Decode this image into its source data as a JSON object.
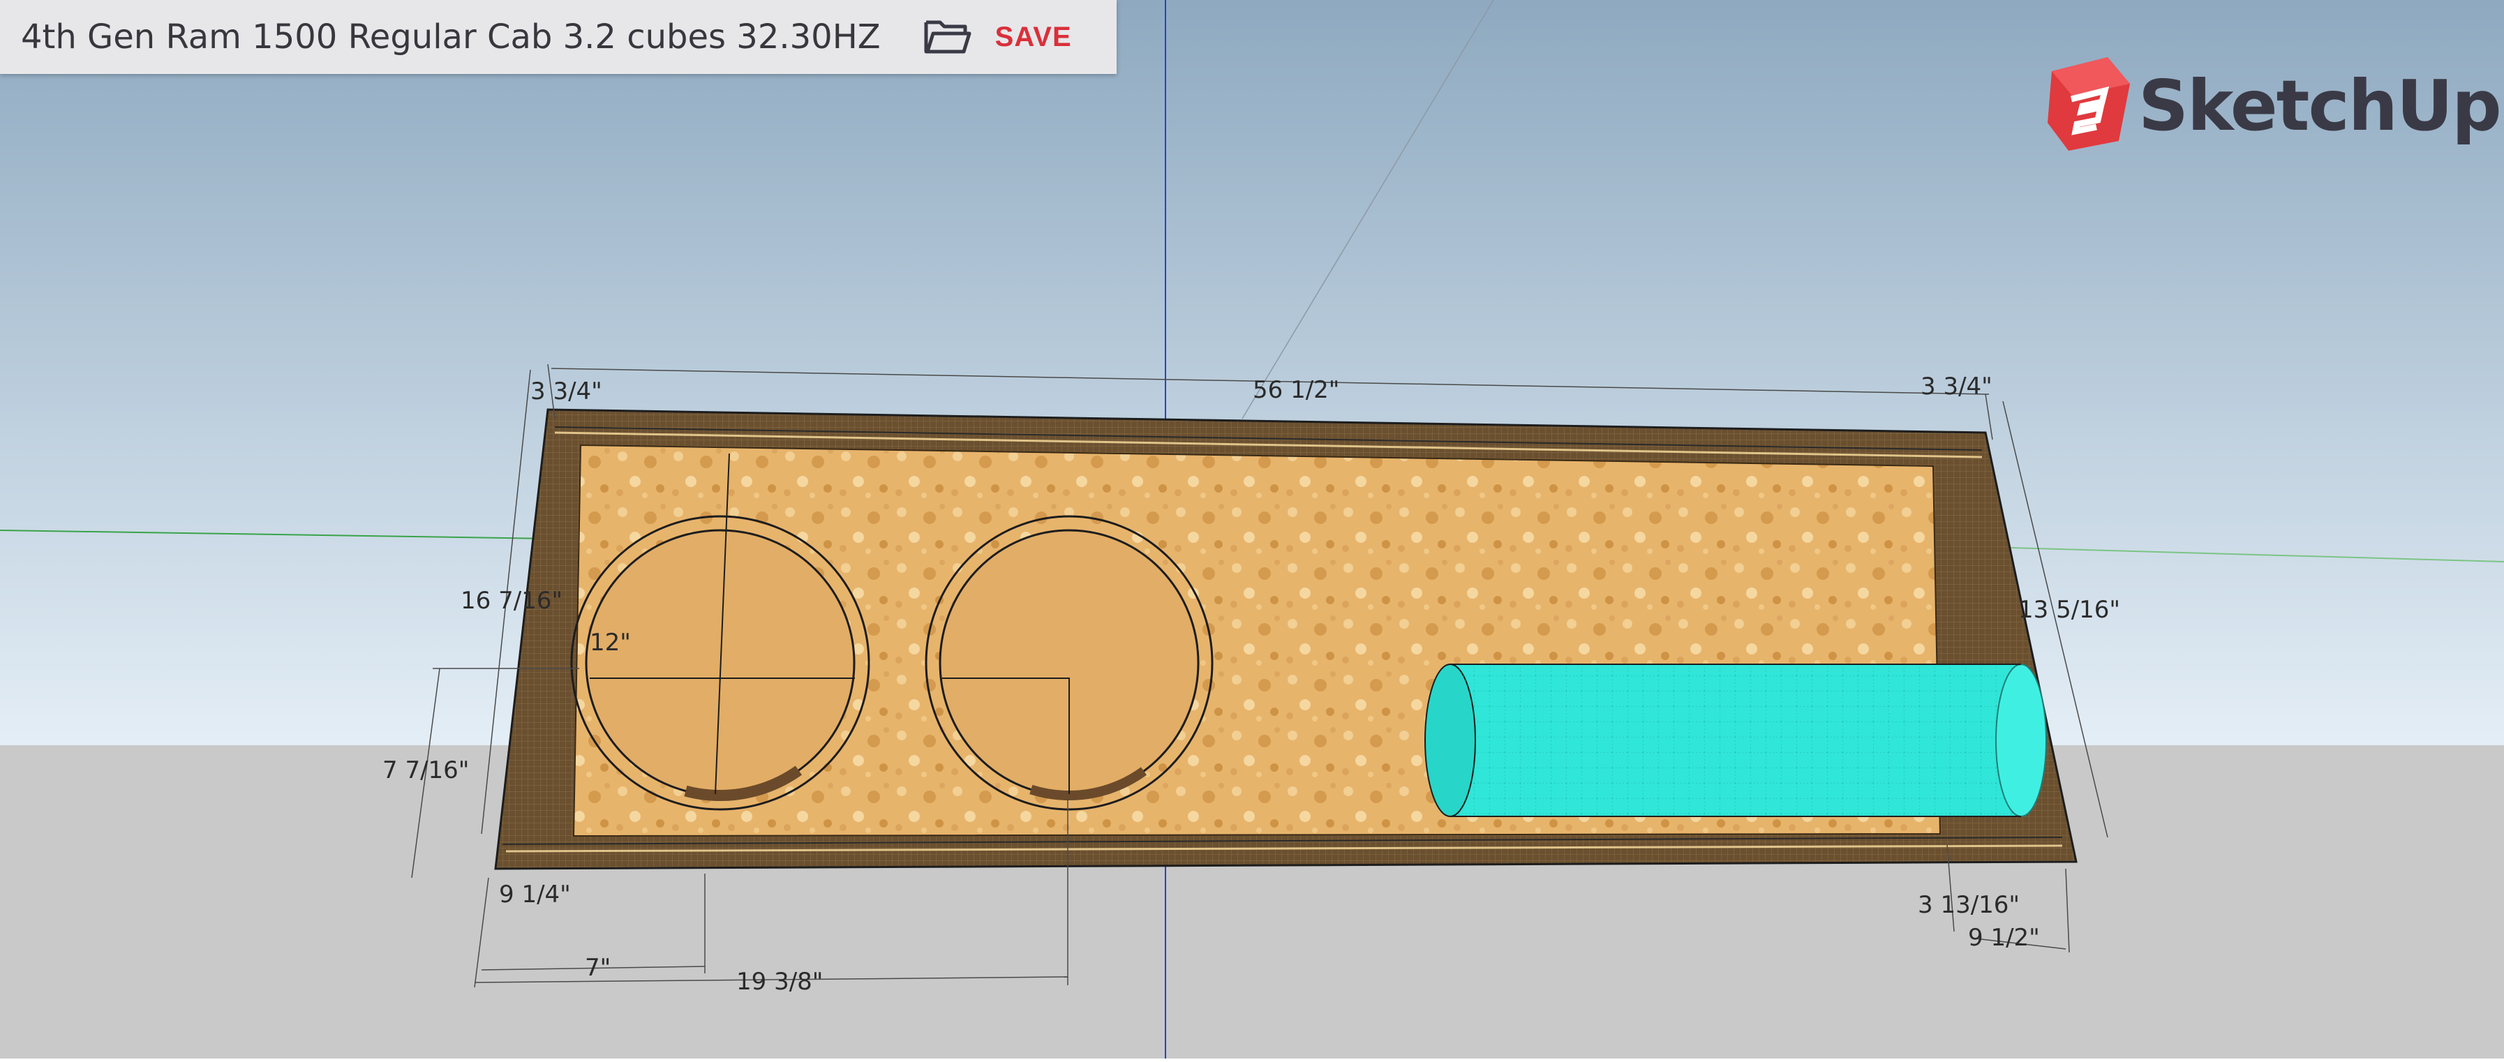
{
  "app": {
    "model_title": "4th Gen Ram 1500 Regular Cab 3.2 cubes 32.30HZ",
    "save_label": "SAVE",
    "brand_name": "SketchUp",
    "icons": {
      "open": "folder-open-icon",
      "logo": "sketchup-logo-icon"
    }
  },
  "dimensions": {
    "top_left_thickness": "3 3/4\"",
    "overall_width": "56 1/2\"",
    "top_right_thickness": "3 3/4\"",
    "left_height": "16 7/16\"",
    "right_height": "13 5/16\"",
    "sub_radius": "12\"",
    "lower_height": "7 7/16\"",
    "bottom_left_depth": "9 1/4\"",
    "hole_center_1": "7\"",
    "hole_center_2": "19 3/8\"",
    "bottom_right_small": "3 13/16\"",
    "bottom_right_depth": "9 1/2\""
  },
  "colors": {
    "sky_top": "#8fabc2",
    "sky_bottom": "#dde9f2",
    "ground": "#c9c9c9",
    "box_frame": "#6b5030",
    "mdf": "#e6b066",
    "port": "#2ee8d9",
    "save_red": "#d9303a",
    "logo_red": "#e03a3e"
  }
}
